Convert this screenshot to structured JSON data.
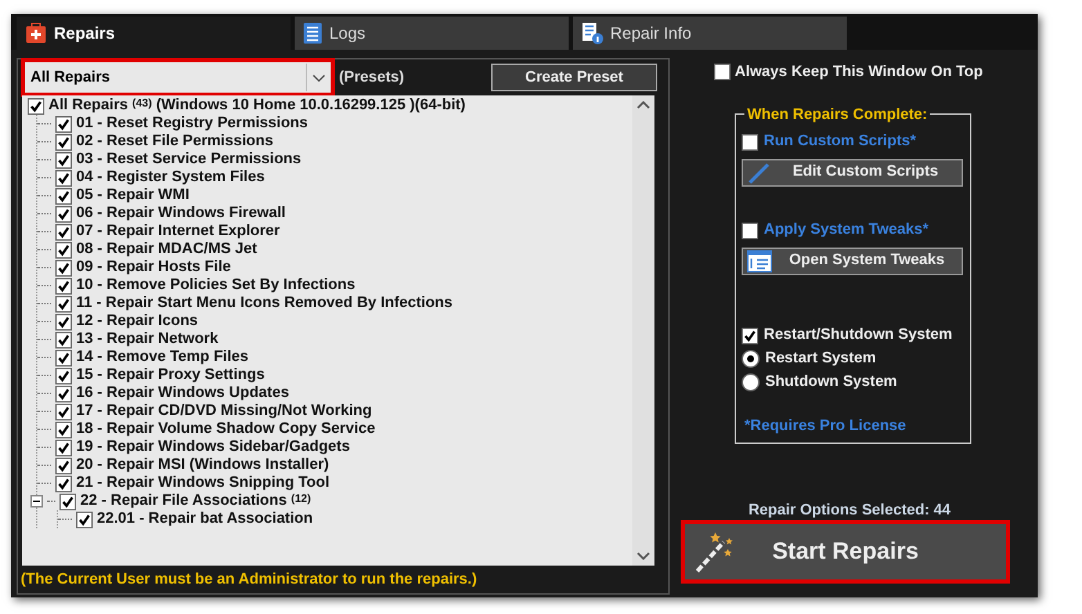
{
  "tabs": [
    {
      "label": "Repairs",
      "selected": true
    },
    {
      "label": "Logs",
      "selected": false
    },
    {
      "label": "Repair Info",
      "selected": false
    }
  ],
  "preset": {
    "value": "All Repairs",
    "highlighted": true
  },
  "presets_label": "(Presets)",
  "create_preset_button": "Create Preset",
  "tree": {
    "label": "All Repairs $^{(43)}$ (Windows 10 Home 10.0.16299.125 )(64-bit)",
    "checked": true,
    "children": [
      {
        "label": "01 - Reset Registry Permissions",
        "checked": true
      },
      {
        "label": "02 - Reset File Permissions",
        "checked": true
      },
      {
        "label": "03 - Reset Service Permissions",
        "checked": true
      },
      {
        "label": "04 - Register System Files",
        "checked": true
      },
      {
        "label": "05 - Repair WMI",
        "checked": true
      },
      {
        "label": "06 - Repair Windows Firewall",
        "checked": true
      },
      {
        "label": "07 - Repair Internet Explorer",
        "checked": true
      },
      {
        "label": "08 - Repair MDAC/MS Jet",
        "checked": true
      },
      {
        "label": "09 - Repair Hosts File",
        "checked": true
      },
      {
        "label": "10 - Remove Policies Set By Infections",
        "checked": true
      },
      {
        "label": "11 - Repair Start Menu Icons Removed By Infections",
        "checked": true
      },
      {
        "label": "12 - Repair Icons",
        "checked": true
      },
      {
        "label": "13 - Repair Network",
        "checked": true
      },
      {
        "label": "14 - Remove Temp Files",
        "checked": true
      },
      {
        "label": "15 - Repair Proxy Settings",
        "checked": true
      },
      {
        "label": "16 - Repair Windows Updates",
        "checked": true
      },
      {
        "label": "17 - Repair CD/DVD Missing/Not Working",
        "checked": true
      },
      {
        "label": "18 - Repair Volume Shadow Copy Service",
        "checked": true
      },
      {
        "label": "19 - Repair Windows Sidebar/Gadgets",
        "checked": true
      },
      {
        "label": "20 - Repair MSI (Windows Installer)",
        "checked": true
      },
      {
        "label": "21 - Repair Windows Snipping Tool",
        "checked": true
      },
      {
        "label": "22 - Repair File Associations $^{(12)}$",
        "checked": true,
        "expanded": true,
        "children": [
          {
            "label": "22.01 - Repair bat Association",
            "checked": true
          }
        ]
      }
    ]
  },
  "footer_note": "(The Current User must be an Administrator to run the repairs.)",
  "always_on_top": {
    "label": "Always Keep This Window On Top",
    "checked": false
  },
  "when_complete": {
    "title": "When Repairs Complete:",
    "items": [
      {
        "kind": "checkbox",
        "label": "Run Custom Scripts*",
        "checked": false,
        "pro": true
      },
      {
        "kind": "button",
        "label": "Edit Custom Scripts"
      },
      {
        "kind": "checkbox",
        "label": "Apply System Tweaks*",
        "checked": false,
        "pro": true
      },
      {
        "kind": "button",
        "label": "Open System Tweaks"
      },
      {
        "kind": "checkbox",
        "label": "Restart/Shutdown System",
        "checked": true,
        "pro": false
      },
      {
        "kind": "radio",
        "label": "Restart System",
        "selected": true
      },
      {
        "kind": "radio",
        "label": "Shutdown System",
        "selected": false
      }
    ],
    "note": "*Requires Pro License"
  },
  "selected_count": "Repair Options Selected: 44",
  "start_button": {
    "label": "Start Repairs",
    "highlighted": true
  }
}
